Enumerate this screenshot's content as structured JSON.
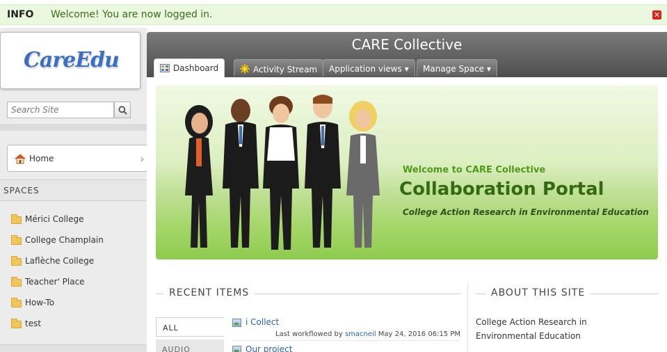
{
  "info_bar": {
    "label": "INFO",
    "message": "Welcome! You are now logged in."
  },
  "sidebar": {
    "logo_text": "CareEdu",
    "search_placeholder": "Search Site",
    "home_label": "Home",
    "spaces_title": "SPACES",
    "spaces": [
      {
        "label": "Mérici College"
      },
      {
        "label": "College Champlain"
      },
      {
        "label": "Laflèche College"
      },
      {
        "label": "Teacher' Place"
      },
      {
        "label": "How-To"
      },
      {
        "label": "test"
      }
    ]
  },
  "header": {
    "space_title": "CARE Collective",
    "tabs": [
      {
        "label": "Dashboard",
        "icon": "dashboard-icon",
        "active": true
      },
      {
        "label": "Activity Stream",
        "icon": "star-icon",
        "active": false
      },
      {
        "label": "Application views ▾",
        "active": false
      },
      {
        "label": "Manage Space ▾",
        "active": false
      }
    ]
  },
  "banner": {
    "welcome": "Welcome to CARE Collective",
    "portal_title": "Collaboration Portal",
    "tagline": "College Action Research in Environmental Education"
  },
  "recent_items": {
    "title": "RECENT ITEMS",
    "filters": [
      {
        "label": "ALL",
        "active": true
      },
      {
        "label": "AUDIO",
        "active": false
      }
    ],
    "items": [
      {
        "title": "i Collect",
        "meta_prefix": "Last workflowed by",
        "user": "smacneil",
        "date": "May 24, 2016 06:15 PM"
      },
      {
        "title": "Our project"
      }
    ]
  },
  "about": {
    "title": "ABOUT THIS SITE",
    "text": "College Action Research in Environmental Education"
  },
  "colors": {
    "info_bg": "#eaf8df",
    "header_dark": "#4e4e4e",
    "banner_green": "#8fcc4f",
    "link_blue": "#2a62a8",
    "portal_green": "#356a13"
  }
}
